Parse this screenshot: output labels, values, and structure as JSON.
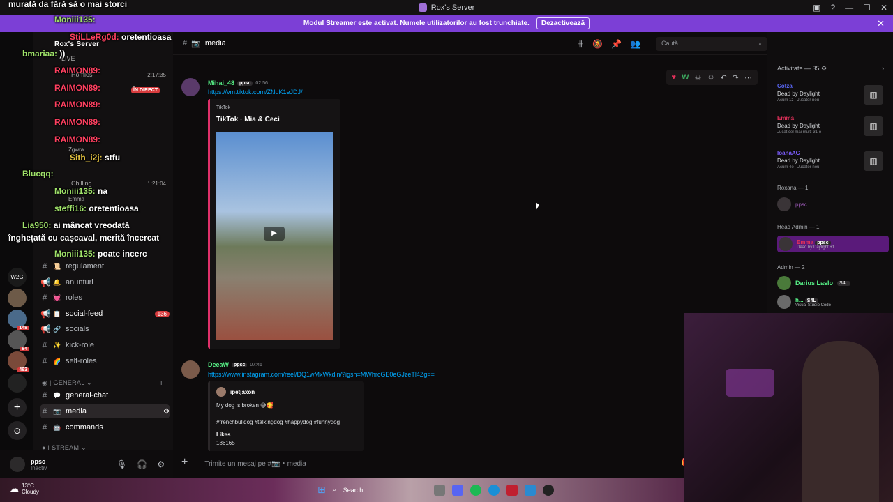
{
  "titlebar": {
    "title": "Rox's Server"
  },
  "banner": {
    "text": "Modul Streamer este activat. Numele utilizatorilor au fost trunchiate.",
    "button": "Dezactivează"
  },
  "channel_header": {
    "name": "media",
    "search_placeholder": "Caută"
  },
  "channels": {
    "server_name": "Rox's Server",
    "voice_items": [
      {
        "label": "LIVE"
      },
      {
        "label": "Homies",
        "time": "2:17:35"
      },
      {
        "label": "ÎN DIRECT"
      },
      {
        "label": "Zgwra"
      },
      {
        "label": "Chilling",
        "time": "1:21:04"
      },
      {
        "label": "Emma"
      }
    ],
    "list": [
      {
        "label": "regulament",
        "emoji": "📜"
      },
      {
        "label": "anunturi",
        "emoji": "🔔"
      },
      {
        "label": "roles",
        "emoji": "💓"
      },
      {
        "label": "social-feed",
        "emoji": "📋",
        "badge": "136"
      },
      {
        "label": "socials",
        "emoji": "🔗"
      },
      {
        "label": "kick-role",
        "emoji": "✨"
      },
      {
        "label": "self-roles",
        "emoji": "🌈"
      }
    ],
    "category_general": "GENERAL",
    "general": [
      {
        "label": "general-chat",
        "emoji": "💬"
      },
      {
        "label": "media",
        "emoji": "📷"
      },
      {
        "label": "commands",
        "emoji": "🤖"
      }
    ],
    "category_stream": "STREAM"
  },
  "userbar": {
    "name": "ppsc",
    "status": "Inactiv"
  },
  "messages": [
    {
      "author": "Mihai_48",
      "tag": "ppsc",
      "time": "02:56",
      "link": "https://vm.tiktok.com/ZNdK1eJDJ/",
      "embed_provider": "TikTok",
      "embed_title": "TikTok · Mia & Ceci"
    },
    {
      "author": "DeeaW",
      "tag": "ppsc",
      "time": "07:46",
      "link": "https://www.instagram.com/reel/DQ1wMxWkdln/?igsh=MWhrcGE0eGJzeTl4Zg==",
      "embed_author": "ipetjaxon",
      "embed_text": "My dog is broken 😅🥰",
      "embed_tags": "#frenchbulldog #talkingdog #happydog #funnydog",
      "embed_likes_label": "Likes",
      "embed_likes": "186165"
    }
  ],
  "composer": {
    "placeholder": "Trimite un mesaj pe #📷・media"
  },
  "members": {
    "activity_header": "Activitate — 35",
    "activities": [
      {
        "name": "Cotza",
        "game": "Dead by Daylight",
        "sub": "Acum 1z · Jucător nou",
        "color": "#5865f2"
      },
      {
        "name": "Emma",
        "game": "Dead by Daylight",
        "sub": "Jucat cel mai mult: 31 o",
        "color": "#e0305a"
      },
      {
        "name": "IoanaAG",
        "game": "Dead by Daylight",
        "sub": "Acum 4o · Jucător nou",
        "color": "#7c5cff"
      }
    ],
    "groups": [
      {
        "title": "Roxana — 1",
        "members": [
          {
            "name": "ppsc",
            "color": "#9b59b6"
          }
        ]
      },
      {
        "title": "Head Admin — 1",
        "members": [
          {
            "name": "Emma",
            "tag": "ppsc",
            "sub": "Dead by Daylight +1",
            "color": "#e0305a"
          }
        ]
      },
      {
        "title": "Admin — 2",
        "members": [
          {
            "name": "Darius Laslo",
            "tag": "S4L",
            "color": "#57f287"
          },
          {
            "name": "h...",
            "tag": "S4L",
            "sub": "Visual Studio Code",
            "color": "#57f287"
          }
        ]
      }
    ]
  },
  "chat_overlay": [
    {
      "user": "",
      "text": "murată da fără să o mai storci"
    },
    {
      "user": "Moniii135:",
      "text": ""
    },
    {
      "user": "StiLLeRg0d:",
      "text": "oretentioasa"
    },
    {
      "user": "bmariaa:",
      "text": "))"
    },
    {
      "user": "RAIMON89:",
      "text": ""
    },
    {
      "user": "RAIMON89:",
      "text": ""
    },
    {
      "user": "RAIMON89:",
      "text": ""
    },
    {
      "user": "RAIMON89:",
      "text": ""
    },
    {
      "user": "RAIMON89:",
      "text": ""
    },
    {
      "user": "Sith_i2j:",
      "text": "stfu"
    },
    {
      "user": "Blucqq:",
      "text": ""
    },
    {
      "user": "Moniii135:",
      "text": "na"
    },
    {
      "user": "steffi16:",
      "text": "oretentioasa"
    },
    {
      "user": "Lia950:",
      "text": "ai mâncat vreodată"
    },
    {
      "user": "",
      "text": "înghețată cu cașcaval, merită încercat"
    },
    {
      "user": "Moniii135:",
      "text": "poate incerc"
    }
  ],
  "taskbar": {
    "temp": "13°C",
    "weather": "Cloudy",
    "search": "Search"
  }
}
